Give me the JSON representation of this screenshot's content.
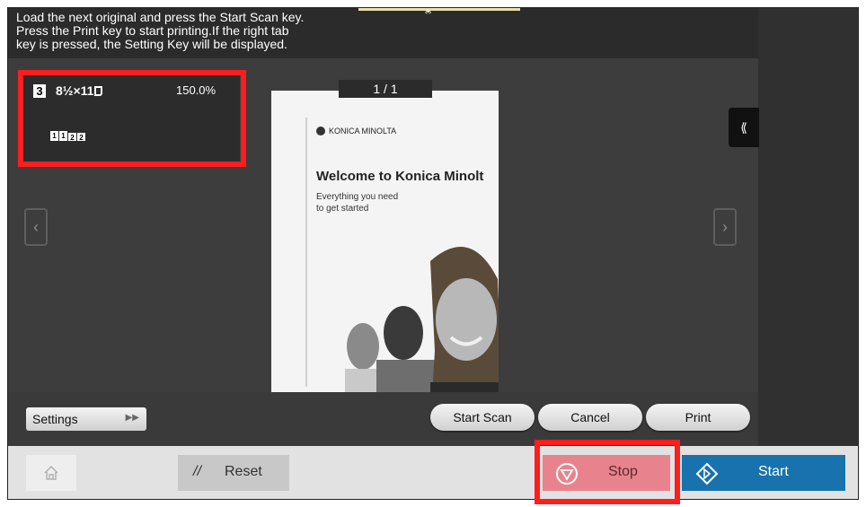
{
  "message": {
    "line1": "Load the next original and press the Start Scan key.",
    "line2": "Press the Print key to start printing.If the right tab",
    "line3": "key is pressed, the Setting Key will be displayed."
  },
  "job_info": {
    "copies": "3",
    "paper": "8½×11",
    "zoom": "150.0%",
    "page_icons": [
      "1",
      "1",
      "2",
      "2"
    ]
  },
  "preview": {
    "page_counter": "1  /  1",
    "brand": "KONICA MINOLTA",
    "headline": "Welcome to Konica Minolt",
    "tagline_1": "Everything you need",
    "tagline_2": "to get started"
  },
  "controls": {
    "settings": "Settings",
    "start_scan": "Start Scan",
    "cancel": "Cancel",
    "print": "Print"
  },
  "bottom": {
    "reset": "Reset",
    "stop": "Stop",
    "start": "Start"
  },
  "colors": {
    "highlight": "#ff1d1d",
    "start_button": "#1872ad",
    "stop_button": "#e8838e"
  },
  "icons": [
    "home-icon",
    "reset-icon",
    "stop-icon",
    "start-icon",
    "collapse-panel-icon",
    "prev-page-icon",
    "next-page-icon",
    "forward-arrows-icon"
  ]
}
